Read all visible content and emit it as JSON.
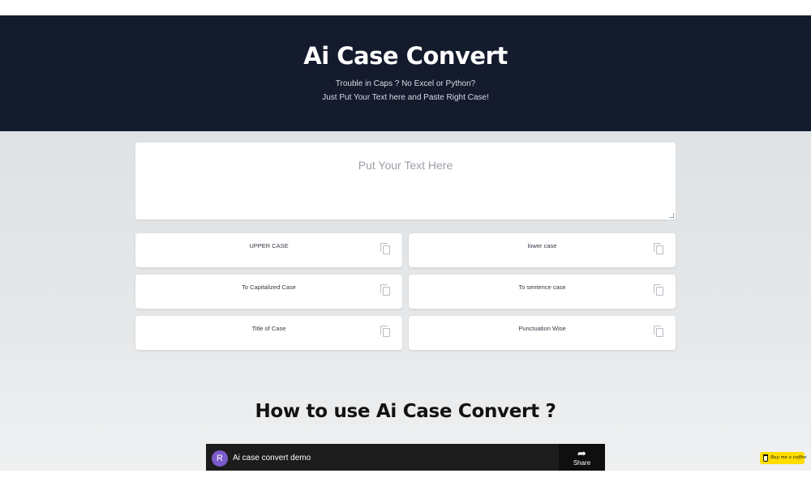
{
  "hero": {
    "title": "Ai Case Convert",
    "subtitle_line1": "Trouble in Caps ? No Excel or Python?",
    "subtitle_line2": "Just Put Your Text here and Paste Right Case!"
  },
  "input": {
    "placeholder": "Put Your Text Here"
  },
  "case_buttons": [
    {
      "label": "UPPER CASE"
    },
    {
      "label": "lower case"
    },
    {
      "label": "To Capitalized Case"
    },
    {
      "label": "To sentence case"
    },
    {
      "label": "Title of Case"
    },
    {
      "label": "Punctuation Wise"
    }
  ],
  "howto": {
    "heading": "How to use Ai Case Convert ?"
  },
  "video": {
    "channel_initial": "R",
    "title": "Ai case convert demo",
    "share_label": "Share"
  },
  "coffee": {
    "label": "Buy me a coffee"
  },
  "colors": {
    "hero_bg": "#141b2d",
    "page_bg": "#e3e6e8",
    "coffee_bg": "#ffdd00",
    "avatar_bg": "#7a5bc9"
  },
  "icons": [
    "copy-icon",
    "share-icon",
    "coffee-cup-icon"
  ]
}
